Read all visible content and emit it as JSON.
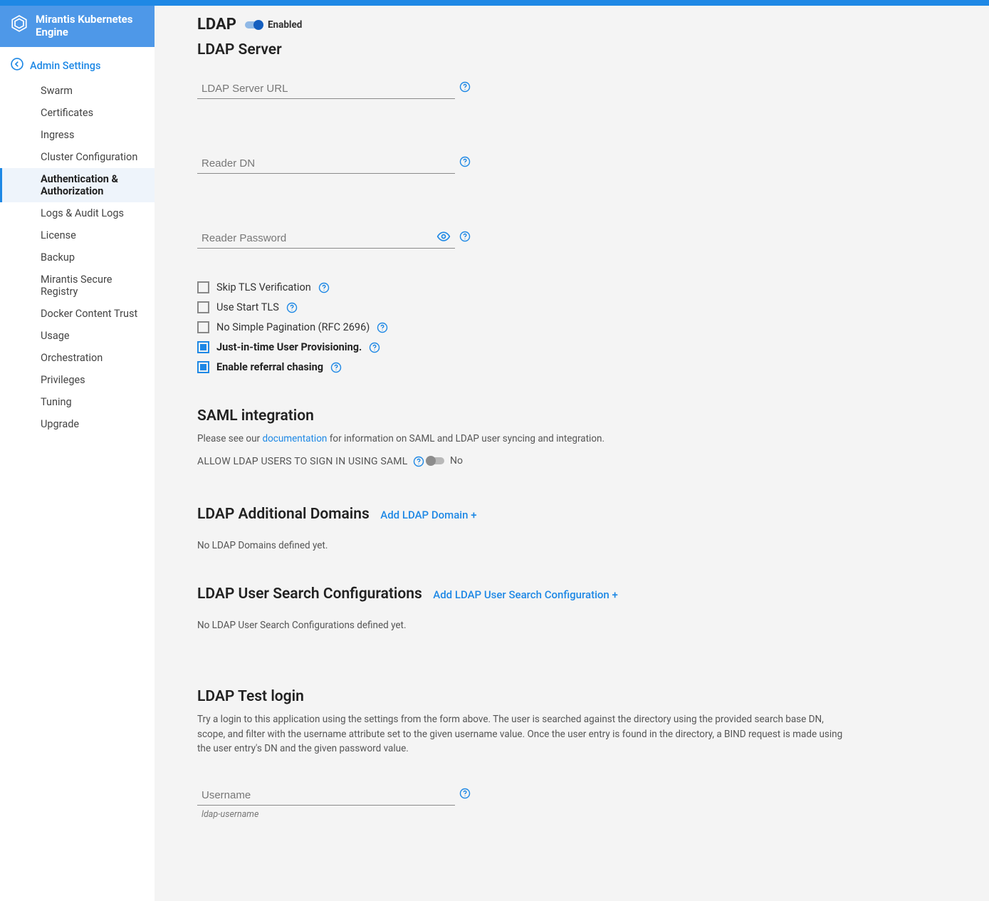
{
  "brand": {
    "title": "Mirantis Kubernetes Engine"
  },
  "nav": {
    "parent": "Admin Settings",
    "items": [
      "Swarm",
      "Certificates",
      "Ingress",
      "Cluster Configuration",
      "Authentication & Authorization",
      "Logs & Audit Logs",
      "License",
      "Backup",
      "Mirantis Secure Registry",
      "Docker Content Trust",
      "Usage",
      "Orchestration",
      "Privileges",
      "Tuning",
      "Upgrade"
    ],
    "activeIndex": 4
  },
  "ldap": {
    "header_title": "LDAP",
    "enabled_label": "Enabled",
    "server_title": "LDAP Server",
    "fields": {
      "server_url_placeholder": "LDAP Server URL",
      "reader_dn_placeholder": "Reader DN",
      "reader_password_placeholder": "Reader Password"
    },
    "checks": {
      "skip_tls": "Skip TLS Verification",
      "start_tls": "Use Start TLS",
      "no_pagination": "No Simple Pagination (RFC 2696)",
      "jit": "Just-in-time User Provisioning.",
      "referral": "Enable referral chasing"
    }
  },
  "saml": {
    "title": "SAML integration",
    "desc_prefix": "Please see our ",
    "doc_link": "documentation",
    "desc_suffix": " for information on SAML and LDAP user syncing and integration.",
    "allow_label": "ALLOW LDAP USERS TO SIGN IN USING SAML",
    "no_label": "No"
  },
  "domains": {
    "title": "LDAP Additional Domains",
    "add": "Add LDAP Domain +",
    "empty": "No LDAP Domains defined yet."
  },
  "search": {
    "title": "LDAP User Search Configurations",
    "add": "Add LDAP User Search Configuration +",
    "empty": "No LDAP User Search Configurations defined yet."
  },
  "test": {
    "title": "LDAP Test login",
    "desc": "Try a login to this application using the settings from the form above. The user is searched against the directory using the provided search base DN, scope, and filter with the username attribute set to the given username value. Once the user entry is found in the directory, a BIND request is made using the user entry's DN and the given password value.",
    "username_placeholder": "Username",
    "username_hint": "ldap-username"
  }
}
